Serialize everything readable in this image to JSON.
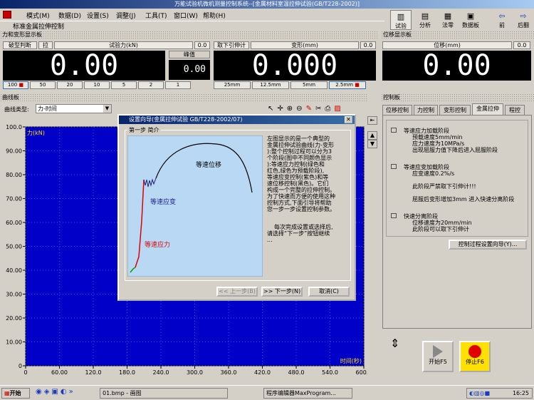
{
  "window": {
    "title": "万能试验机微机测量控制系统--[金属材料室温拉伸试验(GB/T228-2002)]"
  },
  "menu": [
    "模式(M)",
    "数据(D)",
    "设置(S)",
    "调整(J)",
    "工具(T)",
    "窗口(W)",
    "帮助(H)"
  ],
  "document": {
    "name": "标准金属拉伸控制"
  },
  "toolbar": [
    {
      "label": "试验",
      "icon": "bars-icon"
    },
    {
      "label": "分析",
      "icon": "analysis-icon"
    },
    {
      "label": "法零",
      "icon": "zero-icon"
    },
    {
      "label": "数据板",
      "icon": "data-board-icon"
    },
    {
      "label": "前",
      "icon": "arrow-left-icon"
    },
    {
      "label": "后翻",
      "icon": "arrow-right-icon"
    }
  ],
  "force_panel": {
    "section": "力和变形显示板",
    "headers": {
      "break": "破型判断",
      "pull": "拉",
      "force": "试验力(kN)",
      "force_zero": "0.0",
      "take": "取下引伸计",
      "deform": "变形(mm)",
      "deform_zero": "0.0"
    },
    "force_value": "0.00",
    "peak_label": "峰值",
    "peak_value": "0.00",
    "deform_value": "0.000",
    "ranges": [
      "100",
      "50",
      "20",
      "10",
      "5",
      "2",
      "1"
    ],
    "deform_ranges": [
      "25mm",
      "12.5mm",
      "5mm",
      "2.5mm"
    ]
  },
  "position_panel": {
    "section": "位移显示板",
    "header": "位移(mm)",
    "zero": "0.0",
    "value": "0.00"
  },
  "curve_panel": {
    "section": "曲线板",
    "type_label": "曲线类型:",
    "type_value": "力-时间",
    "y_axis_label": "力(kN)",
    "x_axis_label": "时间(秒)"
  },
  "chart_data": {
    "type": "line",
    "xlabel": "时间(秒)",
    "ylabel": "力(kN)",
    "xlim": [
      0,
      600
    ],
    "ylim": [
      0,
      100
    ],
    "x_ticks": [
      "0",
      "60.00",
      "120.0",
      "180.0",
      "240.0",
      "300.0",
      "360.0",
      "420.0",
      "480.0",
      "540.0",
      "600.0"
    ],
    "y_ticks": [
      "100.0",
      "90.00",
      "80.00",
      "70.00",
      "60.00",
      "50.00",
      "40.00",
      "30.00",
      "20.00",
      "10.00",
      "0"
    ],
    "series": []
  },
  "dialog": {
    "title": "设置向导(金属拉伸试验 GB/T228-2002/07)",
    "group": "第一步 简介",
    "curve_labels": {
      "constant_disp": "等速位移",
      "constant_strain": "等速应变",
      "constant_stress": "等速应力"
    },
    "description": [
      "左图显示的是一个典型的",
      "金属拉伸试验曲线(力-变形",
      "):整个控制过程可以分为3",
      "个阶段(图中不同颜色显示",
      "):等速应力控制(绿色和",
      "红色,绿色为预载阶段),",
      "等速应变控制(紫色)和等",
      "速位移控制(黑色)。它们",
      "构成一个完整的拉伸控制。",
      "为了快速而方便的使用这种",
      "控制方式,下面引导将帮助",
      "您一步一步设置控制参数。"
    ],
    "hint": [
      "每次完成设置或选择后,",
      "请选择“下一步”按钮继续",
      "..."
    ],
    "buttons": {
      "prev": "<< 上一步(B)",
      "next": ">> 下一步(N)",
      "cancel": "取消(C)"
    }
  },
  "control_panel": {
    "section": "控制板",
    "tabs": [
      "位移控制",
      "力控制",
      "变形控制",
      "金属拉伸",
      "程控"
    ],
    "steps": [
      {
        "title": "等速应力加载阶段",
        "lines": [
          "预载速度5mm/min",
          "应力速度为10MPa/s",
          "出现屈服力值下降后进入屈服阶段"
        ]
      },
      {
        "title": "等速应变加载阶段",
        "lines": [
          "应变速度0.2%/s",
          "",
          "此阶段严禁取下引伸计!!!",
          "",
          "屈服后变形增加3mm 进入快速分离阶段"
        ]
      },
      {
        "title": "快速分离阶段",
        "lines": [
          "位移速度为20mm/min",
          "此阶段可以取下引伸计"
        ]
      }
    ],
    "wizard_button": "控制过程设置向导(Y)...",
    "start_label": "开始F5",
    "stop_label": "停止F6"
  },
  "taskbar": {
    "start": "开始",
    "items": [
      "01.bmp - 画图",
      "程序编辑器MaxProgram..."
    ],
    "clock": "16:25"
  }
}
